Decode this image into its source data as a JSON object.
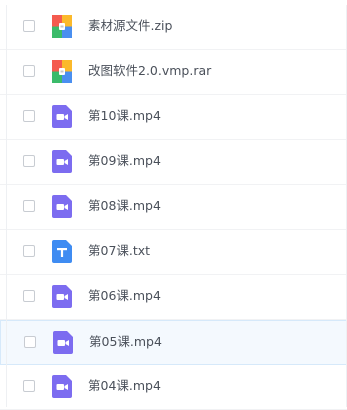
{
  "files": [
    {
      "name": "素材源文件.zip",
      "type": "zip"
    },
    {
      "name": "改图软件2.0.vmp.rar",
      "type": "zip"
    },
    {
      "name": "第10课.mp4",
      "type": "video"
    },
    {
      "name": "第09课.mp4",
      "type": "video"
    },
    {
      "name": "第08课.mp4",
      "type": "video"
    },
    {
      "name": "第07课.txt",
      "type": "text"
    },
    {
      "name": "第06课.mp4",
      "type": "video"
    },
    {
      "name": "第05课.mp4",
      "type": "video",
      "hovered": true
    },
    {
      "name": "第04课.mp4",
      "type": "video"
    }
  ],
  "colors": {
    "video_icon": "#7c6cf0",
    "text_icon": "#3f8cf2",
    "zip_icon": [
      "#f45b4f",
      "#fbb92b",
      "#3bbb6a",
      "#4a8ff0"
    ],
    "row_hover_bg": "#f4f9fe",
    "row_hover_border": "#d6e9fa"
  }
}
